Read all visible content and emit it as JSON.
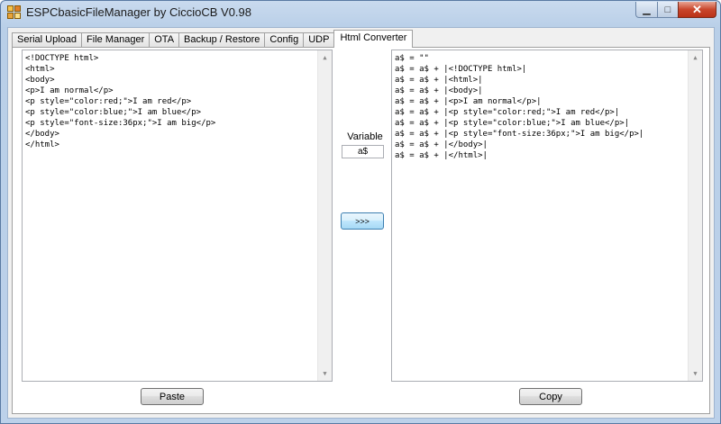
{
  "window": {
    "title": "ESPCbasicFileManager by CiccioCB V0.98",
    "minimize_glyph": "▁",
    "maximize_glyph": "□",
    "close_glyph": "✕"
  },
  "tabs": [
    {
      "label": "Serial Upload",
      "active": false
    },
    {
      "label": "File Manager",
      "active": false
    },
    {
      "label": "OTA",
      "active": false
    },
    {
      "label": "Backup / Restore",
      "active": false
    },
    {
      "label": "Config",
      "active": false
    },
    {
      "label": "UDP",
      "active": false
    },
    {
      "label": "Html Converter",
      "active": true
    }
  ],
  "converter": {
    "input_text": "<!DOCTYPE html>\n<html>\n<body>\n<p>I am normal</p>\n<p style=\"color:red;\">I am red</p>\n<p style=\"color:blue;\">I am blue</p>\n<p style=\"font-size:36px;\">I am big</p>\n</body>\n</html>",
    "output_text": "a$ = \"\"\na$ = a$ + |<!DOCTYPE html>|\na$ = a$ + |<html>|\na$ = a$ + |<body>|\na$ = a$ + |<p>I am normal</p>|\na$ = a$ + |<p style=\"color:red;\">I am red</p>|\na$ = a$ + |<p style=\"color:blue;\">I am blue</p>|\na$ = a$ + |<p style=\"font-size:36px;\">I am big</p>|\na$ = a$ + |</body>|\na$ = a$ + |</html>|",
    "variable_label": "Variable",
    "variable_value": "a$",
    "convert_button": ">>>",
    "paste_button": "Paste",
    "copy_button": "Copy"
  },
  "icons": {
    "app": "app-icon",
    "scroll_up": "▲",
    "scroll_down": "▼"
  }
}
